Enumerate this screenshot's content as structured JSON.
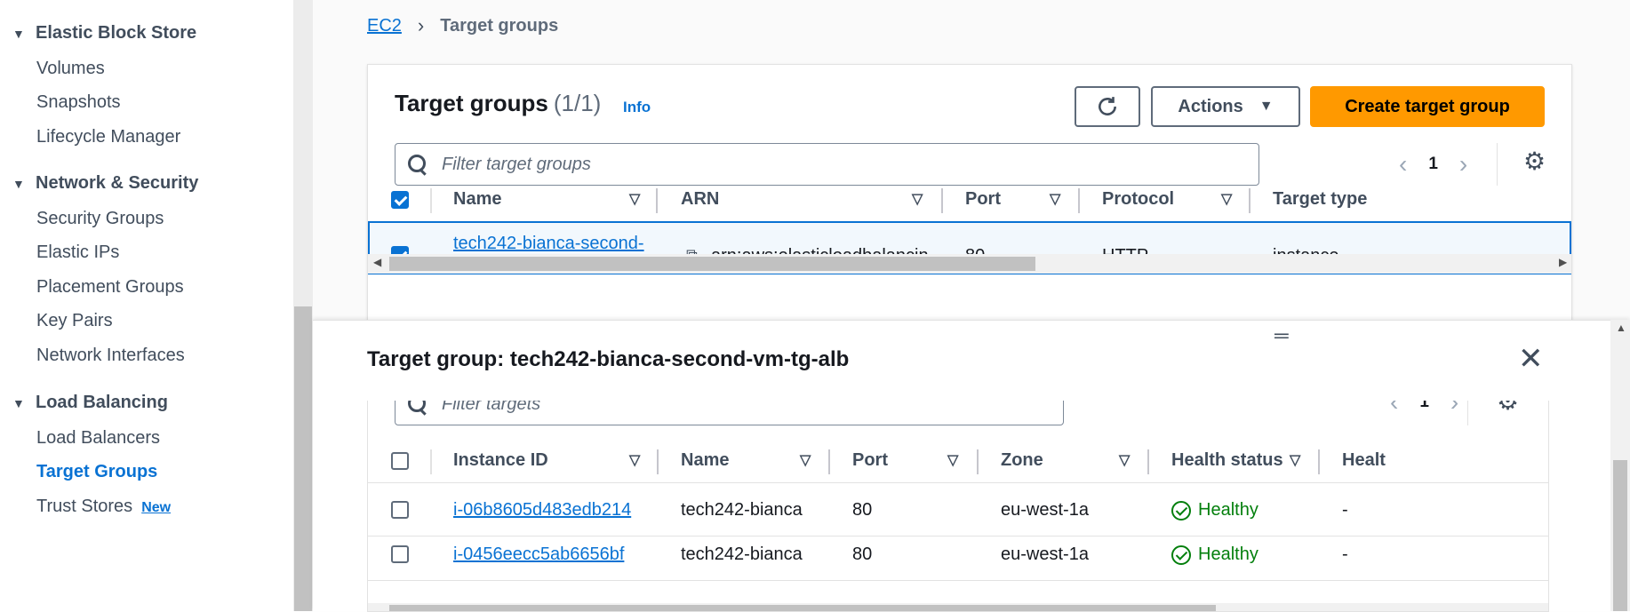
{
  "sidebar": {
    "sections": [
      {
        "label": "Elastic Block Store",
        "items": [
          "Volumes",
          "Snapshots",
          "Lifecycle Manager"
        ]
      },
      {
        "label": "Network & Security",
        "items": [
          "Security Groups",
          "Elastic IPs",
          "Placement Groups",
          "Key Pairs",
          "Network Interfaces"
        ]
      },
      {
        "label": "Load Balancing",
        "items": [
          "Load Balancers",
          "Target Groups",
          "Trust Stores"
        ]
      }
    ],
    "active_item": "Target Groups",
    "new_badge": "New"
  },
  "breadcrumb": {
    "root": "EC2",
    "current": "Target groups"
  },
  "target_groups": {
    "title": "Target groups",
    "count": "(1/1)",
    "info": "Info",
    "actions_label": "Actions",
    "create_label": "Create target group",
    "filter_placeholder": "Filter target groups",
    "page": "1",
    "columns": [
      "Name",
      "ARN",
      "Port",
      "Protocol",
      "Target type"
    ],
    "row": {
      "name": "tech242-bianca-second-",
      "arn": "arn:aws:elasticloadbalancin",
      "port": "80",
      "protocol": "HTTP",
      "target_type": "instance"
    }
  },
  "split_panel": {
    "title": "Target group: tech242-bianca-second-vm-tg-alb",
    "filter_placeholder": "Filter targets",
    "page": "1",
    "columns": [
      "Instance ID",
      "Name",
      "Port",
      "Zone",
      "Health status",
      "Healt"
    ],
    "rows": [
      {
        "instance_id": "i-06b8605d483edb214",
        "name": "tech242-bianca",
        "port": "80",
        "zone": "eu-west-1a",
        "health": "Healthy",
        "health_details": "-"
      },
      {
        "instance_id": "i-0456eecc5ab6656bf",
        "name": "tech242-bianca",
        "port": "80",
        "zone": "eu-west-1a",
        "health": "Healthy",
        "health_details": "-"
      }
    ]
  }
}
